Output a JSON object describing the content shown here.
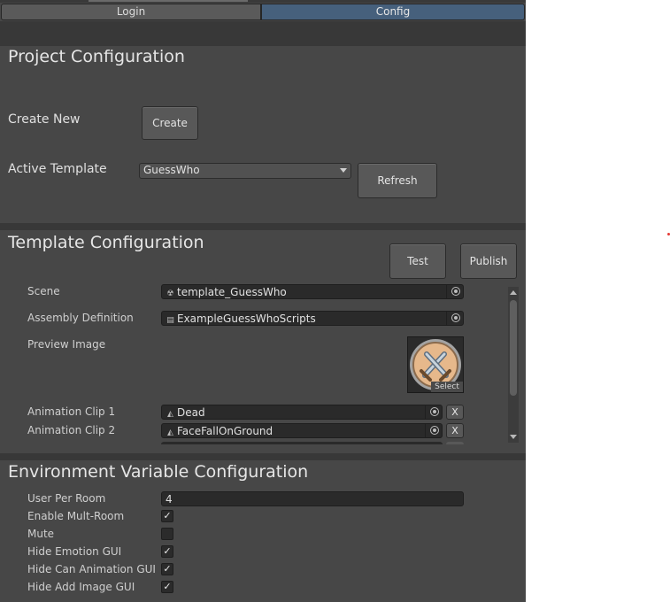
{
  "tabs": [
    {
      "label": "Login",
      "active": false
    },
    {
      "label": "Config",
      "active": true
    }
  ],
  "project_config": {
    "title": "Project Configuration",
    "create_new_label": "Create New",
    "create_button": "Create",
    "active_template_label": "Active Template",
    "active_template_value": "GuessWho",
    "refresh_button": "Refresh"
  },
  "template_config": {
    "title": "Template Configuration",
    "test_button": "Test",
    "publish_button": "Publish",
    "scene_label": "Scene",
    "scene_value": "template_GuessWho",
    "assembly_label": "Assembly Definition",
    "assembly_value": "ExampleGuessWhoScripts",
    "preview_label": "Preview Image",
    "preview_select": "Select",
    "animation_clips": [
      {
        "label": "Animation Clip 1",
        "value": "Dead",
        "remove": "X"
      },
      {
        "label": "Animation Clip 2",
        "value": "FaceFallOnGround",
        "remove": "X"
      }
    ]
  },
  "env_config": {
    "title": "Environment Variable Configuration",
    "user_per_room_label": "User Per Room",
    "user_per_room_value": "4",
    "toggles": [
      {
        "label": "Enable Mult-Room",
        "checked": true
      },
      {
        "label": "Mute",
        "checked": false
      },
      {
        "label": "Hide Emotion GUI",
        "checked": true
      },
      {
        "label": "Hide Can Animation GUI",
        "checked": true
      },
      {
        "label": "Hide Add Image GUI",
        "checked": true
      }
    ]
  },
  "glyphs": {
    "check": "✓"
  },
  "colors": {
    "panel_bg": "#474747",
    "active_tab": "#46607c",
    "field_bg": "#2a2a2a",
    "accent_dot": "#e53935"
  }
}
